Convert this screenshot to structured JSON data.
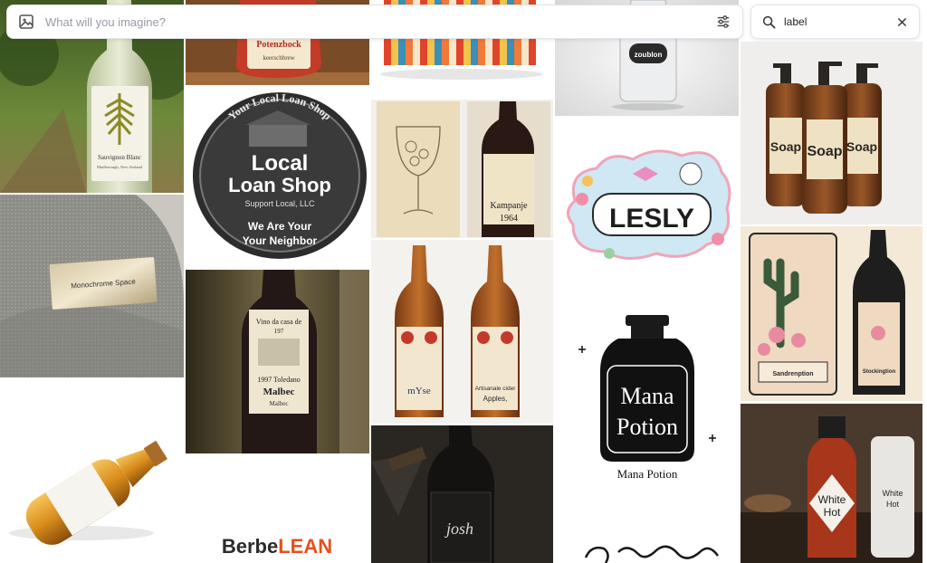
{
  "prompt": {
    "placeholder": "What will you imagine?",
    "value": ""
  },
  "search": {
    "value": "label"
  },
  "icons": {
    "prompt_leading": "image-icon",
    "prompt_trailing": "sliders-icon",
    "search_leading": "search-icon",
    "search_trailing": "close-icon"
  },
  "tiles": {
    "t1": {
      "label_line1": "Sauvignon Blanc",
      "label_line2": "Marlborough, New Zealand"
    },
    "t2": {
      "label_line1": "Monochrome Space"
    },
    "t4": {
      "label_line1": "Potenzbock",
      "label_line2": "keerschbrew"
    },
    "t5": {
      "arc_top": "Your Local Loan Shop",
      "line1": "Local",
      "line2": "Loan Shop",
      "line3": "Support Local, LLC",
      "line4": "We Are Your",
      "line5": "Your Neighbor"
    },
    "t6": {
      "line1": "Vino da casa de",
      "line2": "197",
      "line3": "1997 Toledano",
      "line4": "Malbec",
      "line5": "Malbec"
    },
    "t7": {
      "brand_left": "Berbe",
      "brand_right": "LEAN"
    },
    "t9": {
      "label_line1": "Kampanje",
      "label_line2": "1964"
    },
    "t10": {
      "label_left": "mYse",
      "label_right1": "Artisanale cider",
      "label_right2": "Apples,"
    },
    "t11": {
      "label_line1": "josh"
    },
    "t12": {
      "label_line1": "zoublon"
    },
    "t13": {
      "label_line1": "LESLY"
    },
    "t14": {
      "line1": "Mana",
      "line2": "Potion",
      "caption": "Mana Potion"
    },
    "t16": {
      "label_line1": "Soap",
      "label_line2": "Soap",
      "label_line3": "Soap"
    },
    "t17": {
      "label_left": "Sandrenption",
      "label_right": "Stockingtion"
    },
    "t18": {
      "line1": "White",
      "line2": "Hot",
      "line3": "White",
      "line4": "Hot"
    }
  },
  "colors": {
    "bar_border": "#e4e4ea",
    "placeholder": "#9a9aa6",
    "berbe": "#2b2b2b",
    "lean": "#e8501c"
  }
}
